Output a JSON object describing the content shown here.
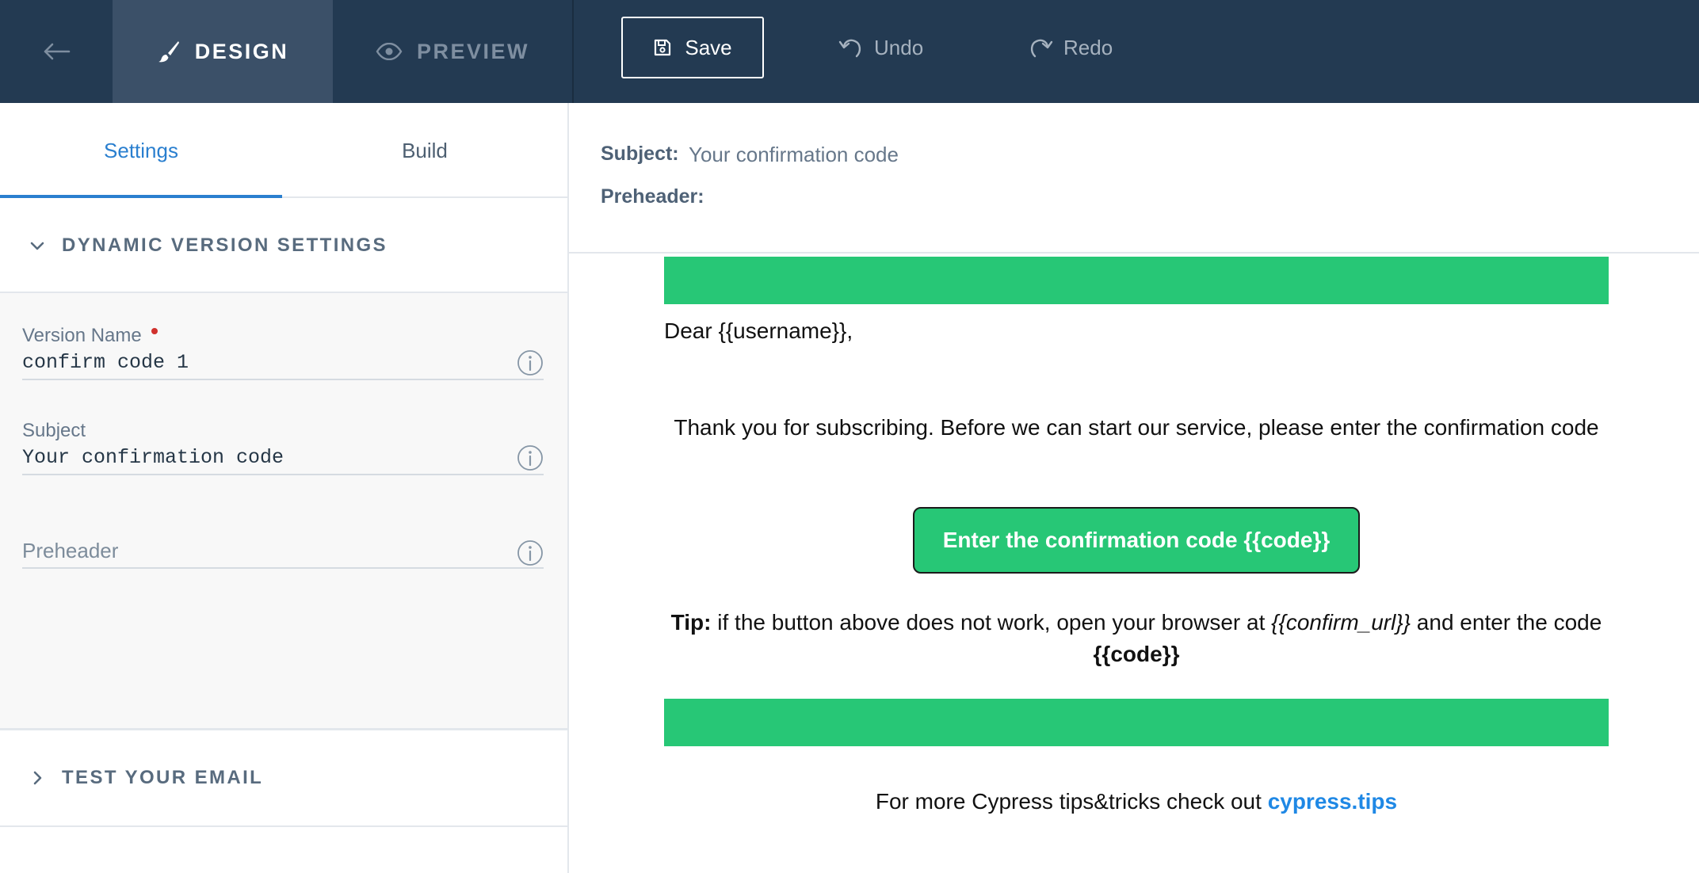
{
  "topbar": {
    "design_label": "DESIGN",
    "preview_label": "PREVIEW",
    "save_label": "Save",
    "undo_label": "Undo",
    "redo_label": "Redo"
  },
  "sidebar": {
    "tabs": [
      {
        "label": "Settings",
        "active": true
      },
      {
        "label": "Build",
        "active": false
      }
    ],
    "dynamic_section_title": "DYNAMIC VERSION SETTINGS",
    "fields": {
      "version_name": {
        "label": "Version Name",
        "value": "confirm code 1",
        "required": true
      },
      "subject": {
        "label": "Subject",
        "value": "Your confirmation code"
      },
      "preheader": {
        "placeholder": "Preheader",
        "value": ""
      }
    },
    "test_section_title": "TEST YOUR EMAIL"
  },
  "email_meta": {
    "subject_label": "Subject:",
    "subject_value": "Your confirmation code",
    "preheader_label": "Preheader:"
  },
  "email_body": {
    "greeting": "Dear {{username}},",
    "intro": "Thank you for subscribing. Before we can start our service, please enter the confirmation code",
    "cta_label": "Enter the confirmation code {{code}}",
    "tip_label": "Tip:",
    "tip_text_1": " if the button above does not work, open your browser at ",
    "tip_url": "{{confirm_url}}",
    "tip_text_2": " and enter the code",
    "tip_code": "{{code}}",
    "footer_text": "For more Cypress tips&tricks check out ",
    "footer_link": "cypress.tips"
  },
  "colors": {
    "topbar_bg": "#233a52",
    "active_mode_bg": "#3b5068",
    "accent_blue": "#2a7fcf",
    "email_green": "#27c776",
    "link_blue": "#1f88e5",
    "required_red": "#d0312d"
  }
}
